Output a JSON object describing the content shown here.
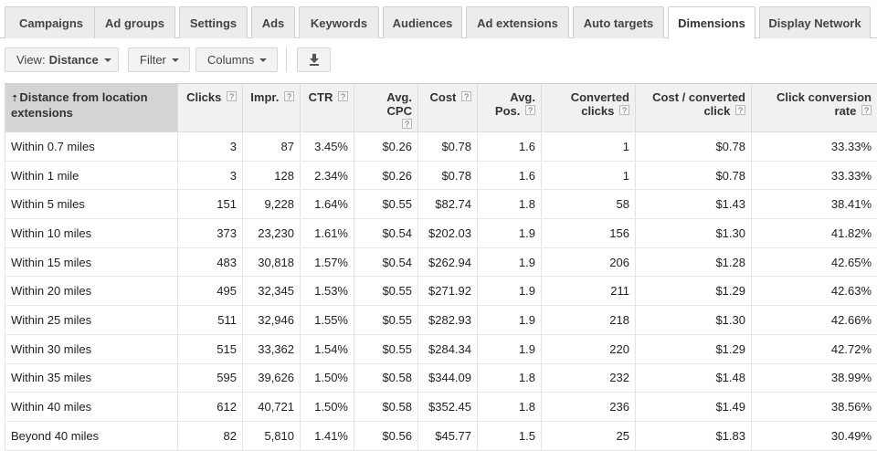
{
  "tabs": [
    {
      "label": "Campaigns"
    },
    {
      "label": "Ad groups"
    },
    {
      "label": "Settings"
    },
    {
      "label": "Ads"
    },
    {
      "label": "Keywords"
    },
    {
      "label": "Audiences"
    },
    {
      "label": "Ad extensions"
    },
    {
      "label": "Auto targets"
    },
    {
      "label": "Dimensions"
    },
    {
      "label": "Display Network"
    }
  ],
  "toolbar": {
    "view_prefix": "View:",
    "view_value": "Distance",
    "filter_label": "Filter",
    "columns_label": "Columns"
  },
  "table": {
    "help_glyph": "?",
    "sort_glyph": "⇡",
    "headers": {
      "distance": "Distance from location extensions",
      "clicks": "Clicks",
      "impr": "Impr.",
      "ctr": "CTR",
      "avg_cpc": "Avg. CPC",
      "cost": "Cost",
      "avg_pos": "Avg. Pos.",
      "converted_clicks": "Converted clicks",
      "cost_per_converted": "Cost / converted click",
      "click_conv_rate": "Click conversion rate"
    },
    "rows": [
      [
        "Within 0.7 miles",
        "3",
        "87",
        "3.45%",
        "$0.26",
        "$0.78",
        "1.6",
        "1",
        "$0.78",
        "33.33%"
      ],
      [
        "Within 1 mile",
        "3",
        "128",
        "2.34%",
        "$0.26",
        "$0.78",
        "1.6",
        "1",
        "$0.78",
        "33.33%"
      ],
      [
        "Within 5 miles",
        "151",
        "9,228",
        "1.64%",
        "$0.55",
        "$82.74",
        "1.8",
        "58",
        "$1.43",
        "38.41%"
      ],
      [
        "Within 10 miles",
        "373",
        "23,230",
        "1.61%",
        "$0.54",
        "$202.03",
        "1.9",
        "156",
        "$1.30",
        "41.82%"
      ],
      [
        "Within 15 miles",
        "483",
        "30,818",
        "1.57%",
        "$0.54",
        "$262.94",
        "1.9",
        "206",
        "$1.28",
        "42.65%"
      ],
      [
        "Within 20 miles",
        "495",
        "32,345",
        "1.53%",
        "$0.55",
        "$271.92",
        "1.9",
        "211",
        "$1.29",
        "42.63%"
      ],
      [
        "Within 25 miles",
        "511",
        "32,946",
        "1.55%",
        "$0.55",
        "$282.93",
        "1.9",
        "218",
        "$1.30",
        "42.66%"
      ],
      [
        "Within 30 miles",
        "515",
        "33,362",
        "1.54%",
        "$0.55",
        "$284.34",
        "1.9",
        "220",
        "$1.29",
        "42.72%"
      ],
      [
        "Within 35 miles",
        "595",
        "39,626",
        "1.50%",
        "$0.58",
        "$344.09",
        "1.8",
        "232",
        "$1.48",
        "38.99%"
      ],
      [
        "Within 40 miles",
        "612",
        "40,721",
        "1.50%",
        "$0.58",
        "$352.45",
        "1.8",
        "236",
        "$1.49",
        "38.56%"
      ],
      [
        "Beyond 40 miles",
        "82",
        "5,810",
        "1.41%",
        "$0.56",
        "$45.77",
        "1.5",
        "25",
        "$1.83",
        "30.49%"
      ]
    ]
  }
}
